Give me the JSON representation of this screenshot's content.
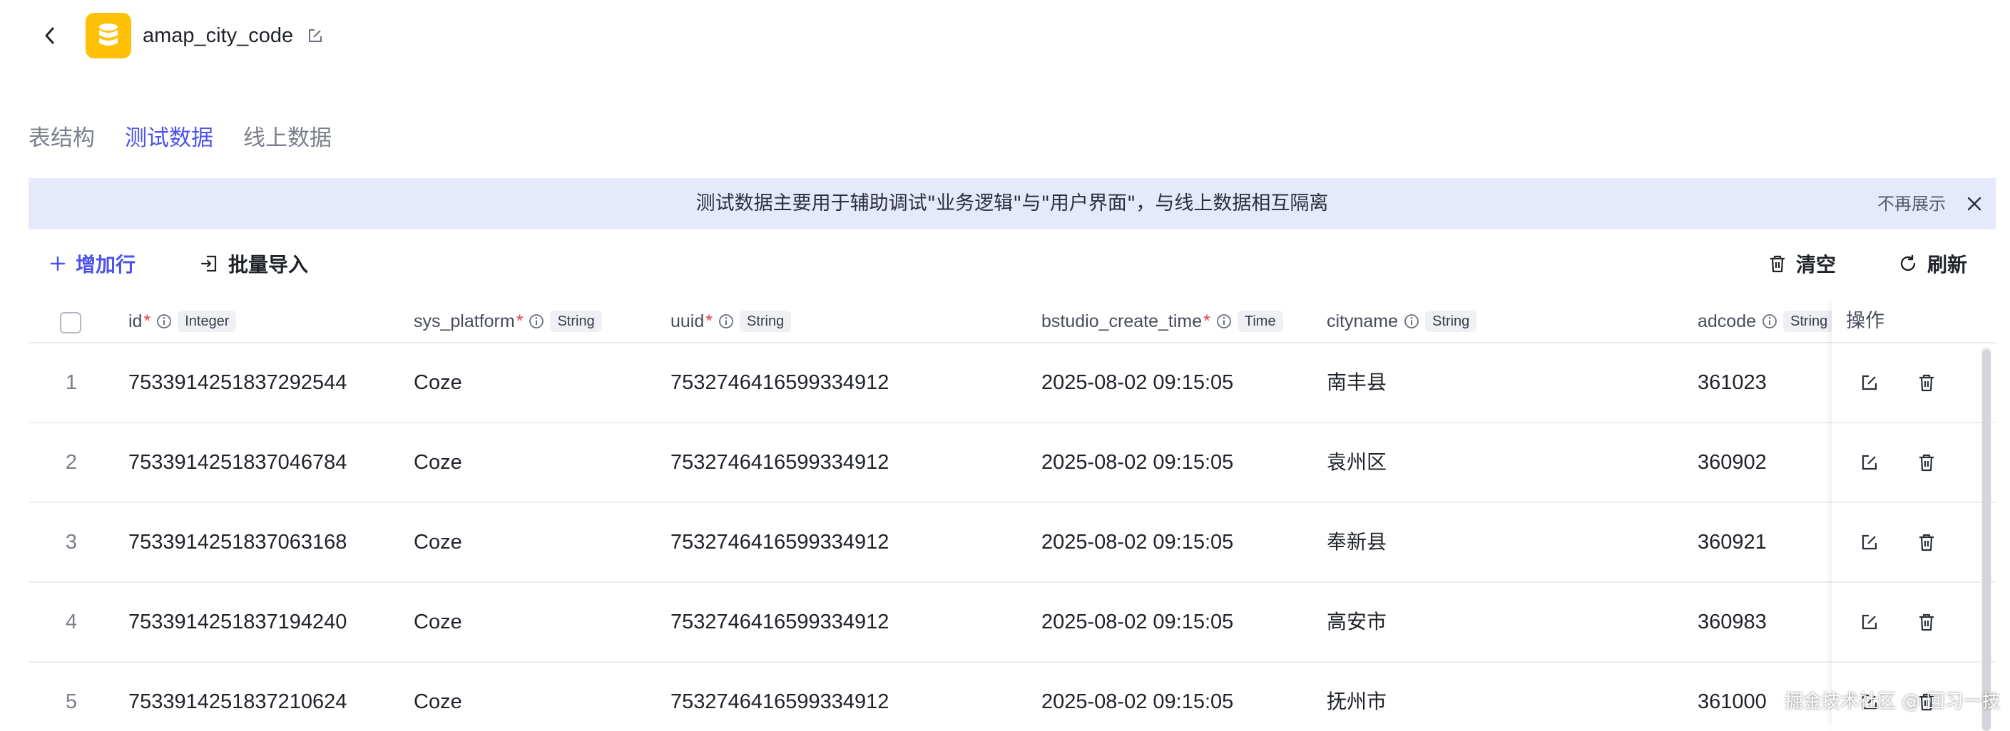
{
  "header": {
    "title": "amap_city_code",
    "icons": {
      "back": "chevron-left-icon",
      "db": "database-icon",
      "edit": "edit-icon"
    },
    "accent_color": "#ffc107"
  },
  "tabs": [
    {
      "label": "表结构",
      "active": false
    },
    {
      "label": "测试数据",
      "active": true
    },
    {
      "label": "线上数据",
      "active": false
    }
  ],
  "banner": {
    "text": "测试数据主要用于辅助调试\"业务逻辑\"与\"用户界面\"，与线上数据相互隔离",
    "dismiss_label": "不再展示",
    "background": "#e6e8fb"
  },
  "toolbar": {
    "add_row": "增加行",
    "batch_import": "批量导入",
    "clear": "清空",
    "refresh": "刷新",
    "accent_color": "#4d53e8"
  },
  "table": {
    "columns": [
      {
        "name": "id",
        "required": true,
        "type": "Integer"
      },
      {
        "name": "sys_platform",
        "required": true,
        "type": "String"
      },
      {
        "name": "uuid",
        "required": true,
        "type": "String"
      },
      {
        "name": "bstudio_create_time",
        "required": true,
        "type": "Time"
      },
      {
        "name": "cityname",
        "required": false,
        "type": "String"
      },
      {
        "name": "adcode",
        "required": false,
        "type": "String"
      }
    ],
    "ops_header": "操作",
    "rows": [
      {
        "index": "1",
        "id": "7533914251837292544",
        "sys_platform": "Coze",
        "uuid": "7532746416599334912",
        "create_time": "2025-08-02 09:15:05",
        "cityname": "南丰县",
        "adcode": "361023"
      },
      {
        "index": "2",
        "id": "7533914251837046784",
        "sys_platform": "Coze",
        "uuid": "7532746416599334912",
        "create_time": "2025-08-02 09:15:05",
        "cityname": "袁州区",
        "adcode": "360902"
      },
      {
        "index": "3",
        "id": "7533914251837063168",
        "sys_platform": "Coze",
        "uuid": "7532746416599334912",
        "create_time": "2025-08-02 09:15:05",
        "cityname": "奉新县",
        "adcode": "360921"
      },
      {
        "index": "4",
        "id": "7533914251837194240",
        "sys_platform": "Coze",
        "uuid": "7532746416599334912",
        "create_time": "2025-08-02 09:15:05",
        "cityname": "高安市",
        "adcode": "360983"
      },
      {
        "index": "5",
        "id": "7533914251837210624",
        "sys_platform": "Coze",
        "uuid": "7532746416599334912",
        "create_time": "2025-08-02 09:15:05",
        "cityname": "抚州市",
        "adcode": "361000"
      }
    ]
  },
  "watermark": "掘金技术社区 @ 回习一技"
}
